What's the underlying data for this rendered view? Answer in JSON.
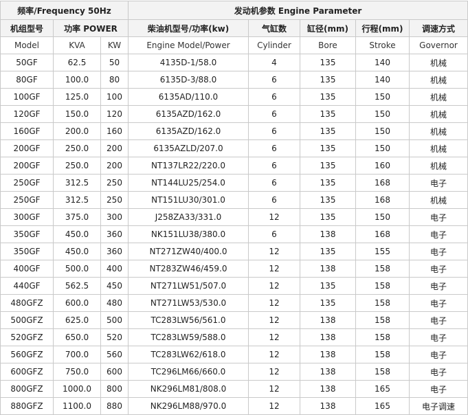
{
  "groups": {
    "frequency": "频率/Frequency 50Hz",
    "engine": "发动机参数 Engine Parameter"
  },
  "headers_cn": {
    "model": "机组型号",
    "power": "功率 POWER",
    "engine_model": "柴油机型号/功率(kw)",
    "cylinder": "气缸数",
    "bore": "缸径(mm)",
    "stroke": "行程(mm)",
    "governor": "调速方式"
  },
  "headers_en": {
    "model": "Model",
    "kva": "KVA",
    "kw": "KW",
    "engine_model": "Engine Model/Power",
    "cylinder": "Cylinder",
    "bore": "Bore",
    "stroke": "Stroke",
    "governor": "Governor"
  },
  "rows": [
    [
      "50GF",
      "62.5",
      "50",
      "4135D-1/58.0",
      "4",
      "135",
      "140",
      "机械"
    ],
    [
      "80GF",
      "100.0",
      "80",
      "6135D-3/88.0",
      "6",
      "135",
      "140",
      "机械"
    ],
    [
      "100GF",
      "125.0",
      "100",
      "6135AD/110.0",
      "6",
      "135",
      "150",
      "机械"
    ],
    [
      "120GF",
      "150.0",
      "120",
      "6135AZD/162.0",
      "6",
      "135",
      "150",
      "机械"
    ],
    [
      "160GF",
      "200.0",
      "160",
      "6135AZD/162.0",
      "6",
      "135",
      "150",
      "机械"
    ],
    [
      "200GF",
      "250.0",
      "200",
      "6135AZLD/207.0",
      "6",
      "135",
      "150",
      "机械"
    ],
    [
      "200GF",
      "250.0",
      "200",
      "NT137LR22/220.0",
      "6",
      "135",
      "160",
      "机械"
    ],
    [
      "250GF",
      "312.5",
      "250",
      "NT144LU25/254.0",
      "6",
      "135",
      "168",
      "电子"
    ],
    [
      "250GF",
      "312.5",
      "250",
      "NT151LU30/301.0",
      "6",
      "135",
      "168",
      "机械"
    ],
    [
      "300GF",
      "375.0",
      "300",
      "J258ZA33/331.0",
      "12",
      "135",
      "150",
      "电子"
    ],
    [
      "350GF",
      "450.0",
      "360",
      "NK151LU38/380.0",
      "6",
      "138",
      "168",
      "电子"
    ],
    [
      "350GF",
      "450.0",
      "360",
      "NT271ZW40/400.0",
      "12",
      "135",
      "155",
      "电子"
    ],
    [
      "400GF",
      "500.0",
      "400",
      "NT283ZW46/459.0",
      "12",
      "138",
      "158",
      "电子"
    ],
    [
      "440GF",
      "562.5",
      "450",
      "NT271LW51/507.0",
      "12",
      "135",
      "158",
      "电子"
    ],
    [
      "480GFZ",
      "600.0",
      "480",
      "NT271LW53/530.0",
      "12",
      "135",
      "158",
      "电子"
    ],
    [
      "500GFZ",
      "625.0",
      "500",
      "TC283LW56/561.0",
      "12",
      "138",
      "158",
      "电子"
    ],
    [
      "520GFZ",
      "650.0",
      "520",
      "TC283LW59/588.0",
      "12",
      "138",
      "158",
      "电子"
    ],
    [
      "560GFZ",
      "700.0",
      "560",
      "TC283LW62/618.0",
      "12",
      "138",
      "158",
      "电子"
    ],
    [
      "600GFZ",
      "750.0",
      "600",
      "TC296LM66/660.0",
      "12",
      "138",
      "158",
      "电子"
    ],
    [
      "800GFZ",
      "1000.0",
      "800",
      "NK296LM81/808.0",
      "12",
      "138",
      "165",
      "电子"
    ],
    [
      "880GFZ",
      "1100.0",
      "880",
      "NK296LM88/970.0",
      "12",
      "138",
      "165",
      "电子调速"
    ]
  ]
}
